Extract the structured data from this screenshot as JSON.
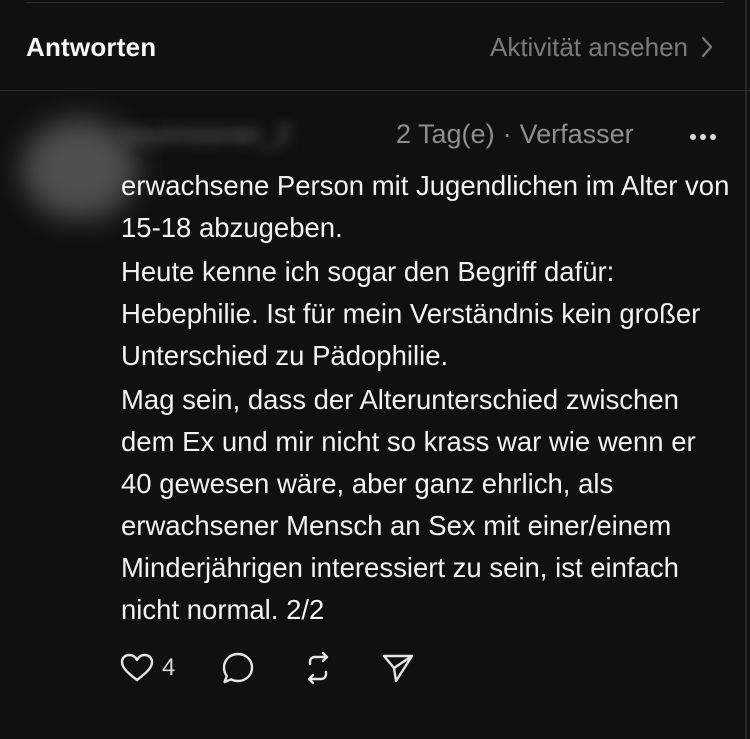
{
  "header": {
    "title": "Antworten",
    "activity_link": "Aktivität ansehen"
  },
  "post": {
    "username_redacted": "noyimooner_2",
    "age": "2 Tag(e)",
    "separator": "·",
    "role": "Verfasser",
    "paragraphs": [
      "erwachsene Person mit Jugendlichen im Alter von 15-18 abzugeben.",
      "Heute kenne ich sogar den Begriff dafür: Hebephilie. Ist für mein Verständnis kein großer Unterschied zu Pädophilie.",
      "Mag sein, dass der Alterunterschied zwischen dem Ex und mir nicht so krass war wie wenn er 40 gewesen wäre, aber ganz ehrlich, als erwachsener Mensch an Sex mit einer/einem Minderjährigen interessiert zu sein, ist einfach nicht normal. 2/2"
    ],
    "like_count": "4"
  },
  "icons": {
    "chevron": "chevron-right-icon",
    "more": "more-horizontal-icon",
    "like": "heart-icon",
    "comment": "comment-bubble-icon",
    "repost": "repost-icon",
    "share": "send-icon"
  },
  "colors": {
    "background": "#101010",
    "text_primary": "#f2f2f2",
    "text_secondary": "#8e8e8e",
    "divider": "#2a2a2a"
  }
}
